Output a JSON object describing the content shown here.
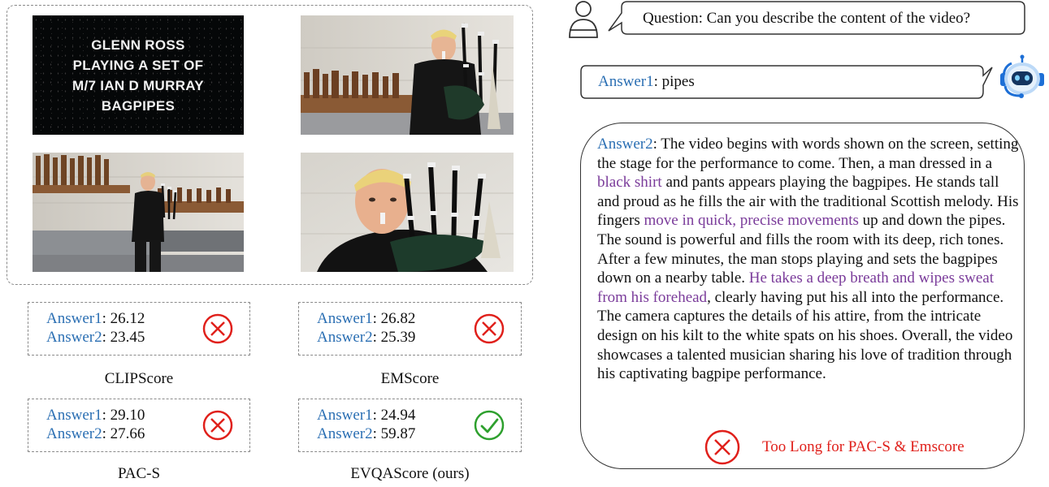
{
  "video": {
    "title_card_lines": [
      "GLENN ROSS",
      "PLAYING A SET OF",
      "M/7 IAN D MURRAY",
      "BAGPIPES"
    ],
    "frames": [
      "title-card",
      "piper-workshop-close",
      "piper-workshop-wide",
      "piper-closeup"
    ]
  },
  "metrics": [
    {
      "name": "CLIPScore",
      "answer1_label": "Answer1",
      "answer1_value": ": 26.12",
      "answer2_label": "Answer2",
      "answer2_value": ": 23.45",
      "verdict": "cross"
    },
    {
      "name": "EMScore",
      "answer1_label": "Answer1",
      "answer1_value": ": 26.82",
      "answer2_label": "Answer2",
      "answer2_value": ": 25.39",
      "verdict": "cross"
    },
    {
      "name": "PAC-S",
      "answer1_label": "Answer1",
      "answer1_value": ": 29.10",
      "answer2_label": "Answer2",
      "answer2_value": ": 27.66",
      "verdict": "cross"
    },
    {
      "name": "EVQAScore (ours)",
      "answer1_label": "Answer1",
      "answer1_value": ": 24.94",
      "answer2_label": "Answer2",
      "answer2_value": ": 59.87",
      "verdict": "check"
    }
  ],
  "question": {
    "text": "Question: Can you describe the content of the video?",
    "icon": "user-icon"
  },
  "answer1": {
    "label": "Answer1",
    "text": ": pipes",
    "icon": "robot-icon"
  },
  "answer2": {
    "label": "Answer2",
    "segments": [
      {
        "text": ": The video begins with words shown on the screen, setting the stage for the performance to come. Then, a man dressed in a ",
        "style": "normal"
      },
      {
        "text": "black shirt",
        "style": "highlight"
      },
      {
        "text": " and pants appears playing the bagpipes. He stands tall and proud as he fills the air with the traditional Scottish melody. His fingers ",
        "style": "normal"
      },
      {
        "text": "move in quick, precise movements",
        "style": "highlight"
      },
      {
        "text": " up and down the pipes. The sound is powerful and fills the room with its deep, rich tones. After a few minutes, the man stops playing and sets the bagpipes down on a nearby table. ",
        "style": "normal"
      },
      {
        "text": "He takes a deep breath and wipes sweat from his forehead",
        "style": "highlight"
      },
      {
        "text": ", clearly having put his all into the performance. The camera captures the details of his attire, from the intricate design on his kilt to the white spats on his shoes. Overall, the video showcases a talented musician sharing his love of tradition through his captivating bagpipe performance.",
        "style": "normal"
      }
    ],
    "warning": "Too Long for PAC-S & Emscore"
  },
  "colors": {
    "label_blue": "#2b6fb3",
    "highlight_purple": "#7a3b9a",
    "cross_red": "#e0201b",
    "check_green": "#2ea02e"
  }
}
